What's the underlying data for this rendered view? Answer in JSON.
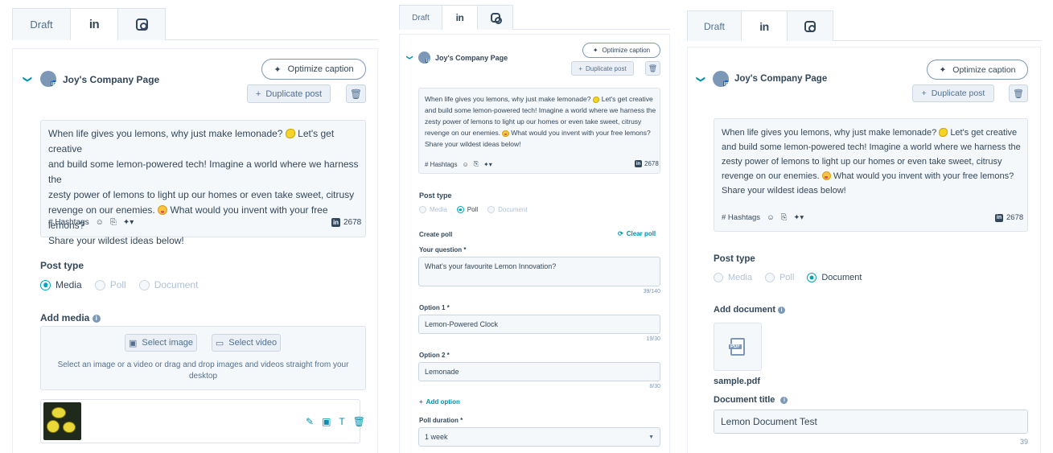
{
  "tabs": {
    "draft": "Draft",
    "linkedin": "in"
  },
  "account": {
    "name": "Joy's Company Page"
  },
  "actions": {
    "optimize": "Optimize caption",
    "duplicate": "Duplicate post",
    "optimize_icon": "sparkle-icon",
    "duplicate_icon": "plus-icon",
    "delete_icon": "trash-icon"
  },
  "caption": {
    "line1": "When life gives you lemons, why just make lemonade?",
    "line1b": "Let's get creative",
    "line2": "and build some lemon-powered tech! Imagine a world where we harness the",
    "line3": "zesty power of lemons to light up our homes or even take sweet, citrusy",
    "line4a": "revenge on our enemies.",
    "line4b": "What would you invent with your free lemons?",
    "line5": "Share your wildest ideas below!",
    "emoji1": "lemon-emoji",
    "emoji2": "tongue-out-emoji"
  },
  "composer_toolbar": {
    "hashtags": "# Hashtags",
    "char_count": "2678",
    "icons": [
      "emoji-icon",
      "attachment-icon",
      "ai-sparkle-icon"
    ]
  },
  "post_type": {
    "label": "Post type",
    "options": [
      "Media",
      "Poll",
      "Document"
    ]
  },
  "panel1": {
    "selected_type": "Media",
    "add_media": "Add media",
    "select_image": "Select image",
    "select_video": "Select video",
    "drop_hint_1": "Select an image or a video or drag and drop images and videos straight from your",
    "drop_hint_2": "desktop",
    "media_tools": [
      "edit-icon",
      "image-icon",
      "text-icon",
      "trash-icon"
    ]
  },
  "panel2": {
    "selected_type": "Poll",
    "create_poll": "Create poll",
    "clear_poll": "Clear poll",
    "question_label": "Your question *",
    "question_value": "What's your favourite Lemon Innovation?",
    "question_count": "39/140",
    "option1_label": "Option 1 *",
    "option1_value": "Lemon-Powered Clock",
    "option1_count": "19/30",
    "option2_label": "Option 2 *",
    "option2_value": "Lemonade",
    "option2_count": "8/30",
    "add_option": "Add option",
    "duration_label": "Poll duration *",
    "duration_value": "1 week"
  },
  "panel3": {
    "selected_type": "Document",
    "add_document": "Add document",
    "file_name": "sample.pdf",
    "doc_title_label": "Document title",
    "doc_title_value": "Lemon Document Test",
    "doc_title_count": "39"
  }
}
